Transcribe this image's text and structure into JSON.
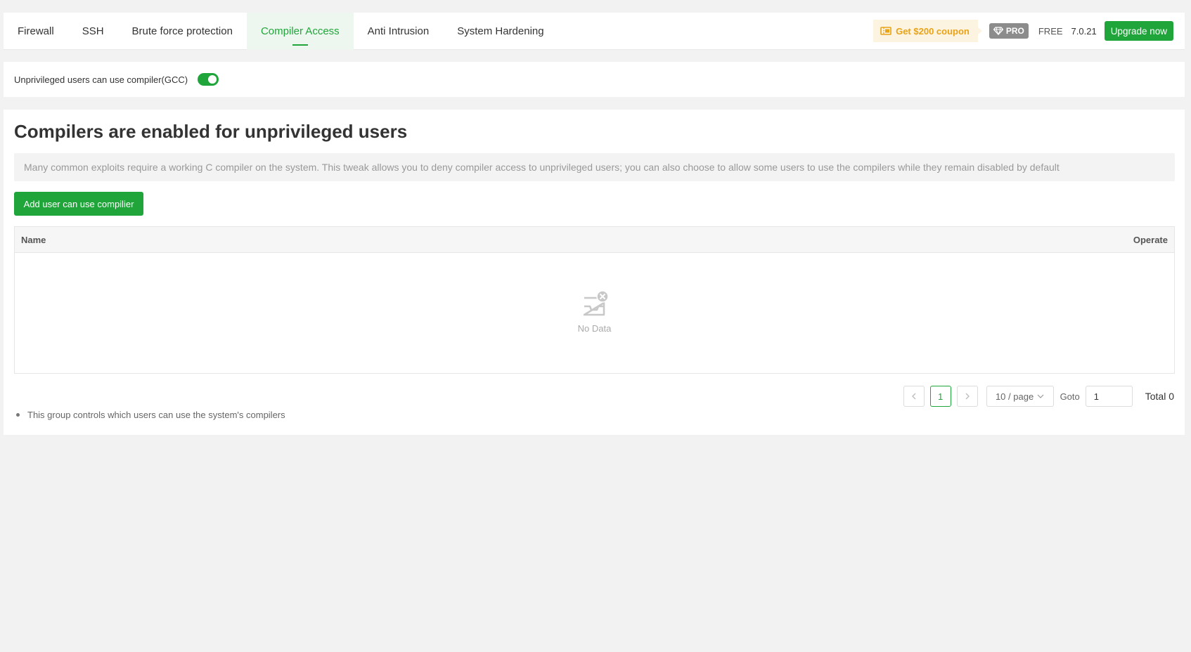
{
  "tabs": [
    {
      "label": "Firewall",
      "active": false
    },
    {
      "label": "SSH",
      "active": false
    },
    {
      "label": "Brute force protection",
      "active": false
    },
    {
      "label": "Compiler Access",
      "active": true
    },
    {
      "label": "Anti Intrusion",
      "active": false
    },
    {
      "label": "System Hardening",
      "active": false
    }
  ],
  "header": {
    "coupon_label": "Get $200 coupon",
    "pro_badge": "PRO",
    "edition": "FREE",
    "version": "7.0.21",
    "upgrade_label": "Upgrade now"
  },
  "toggle": {
    "label": "Unprivileged users can use compiler(GCC)",
    "enabled": true
  },
  "main": {
    "title": "Compilers are enabled for unprivileged users",
    "description": "Many common exploits require a working C compiler on the system. This tweak allows you to deny compiler access to unprivileged users; you can also choose to allow some users to use the compilers while they remain disabled by default",
    "add_button_label": "Add user can use compilier"
  },
  "table": {
    "columns": [
      "Name",
      "Operate"
    ],
    "rows": [],
    "empty_text": "No Data"
  },
  "pagination": {
    "current_page": "1",
    "page_size": "10 / page",
    "goto_label": "Goto",
    "goto_value": "1",
    "total": "Total 0"
  },
  "notes": [
    "This group controls which users can use the system's compilers"
  ],
  "colors": {
    "accent": "#20a53a",
    "coupon": "#e8a317",
    "coupon_bg": "#fdf3e1",
    "pro_badge": "#8c8c8c"
  },
  "icons": {
    "coupon": "coupon-ticket-icon",
    "pro": "diamond-icon",
    "empty": "empty-inbox-icon",
    "prev": "chevron-left-icon",
    "next": "chevron-right-icon",
    "page_size": "chevron-down-icon"
  }
}
